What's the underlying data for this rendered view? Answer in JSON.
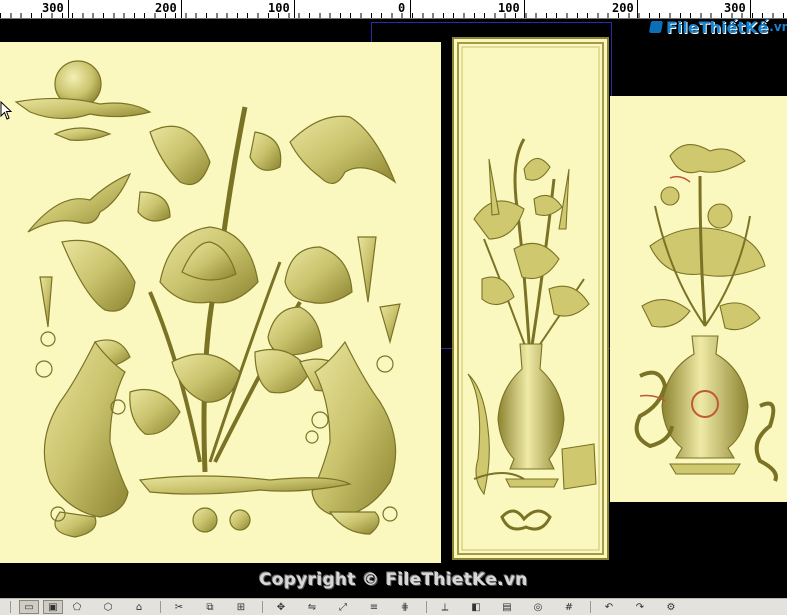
{
  "ruler": {
    "labels": [
      "300",
      "200",
      "100",
      "0",
      "100",
      "200",
      "300"
    ]
  },
  "logo": {
    "brand": "FileThiếtKế",
    "domain": ".vn",
    "icon": "logo-square-icon"
  },
  "watermark": {
    "text": "Copyright © FileThietKe.vn"
  },
  "panels": [
    {
      "name": "lotus-carp-relief",
      "subject": "lotus-koi-carving-image"
    },
    {
      "name": "lotus-vase-relief",
      "subject": "vase-bouquet-carving-image"
    },
    {
      "name": "lotus-vase-relief-2",
      "subject": "vase-dragon-carving-image"
    }
  ],
  "toolbar": {
    "icons": [
      "view-icon",
      "pan-icon",
      "rotate-icon",
      "zoom-icon",
      "fit-icon",
      "cut-icon",
      "copy-icon",
      "paste-icon",
      "move-icon",
      "mirror-icon",
      "scale-icon",
      "align-icon",
      "snap-icon",
      "measure-icon",
      "shade-icon",
      "layer-icon",
      "render-icon",
      "grid-icon",
      "undo-icon",
      "redo-icon",
      "settings-icon"
    ],
    "glyphs": [
      "▭",
      "▣",
      "⬠",
      "⬡",
      "⌂",
      "✂",
      "⧉",
      "⊞",
      "✥",
      "⇋",
      "⤢",
      "≡",
      "⋕",
      "⟂",
      "◧",
      "▤",
      "◎",
      "#",
      "↶",
      "↷",
      "⚙"
    ]
  },
  "colors": {
    "relief_bg": "#fbf8bf",
    "relief_mid": "#cfc86f",
    "relief_dark": "#8c8430",
    "relief_light": "#f2eeae"
  }
}
